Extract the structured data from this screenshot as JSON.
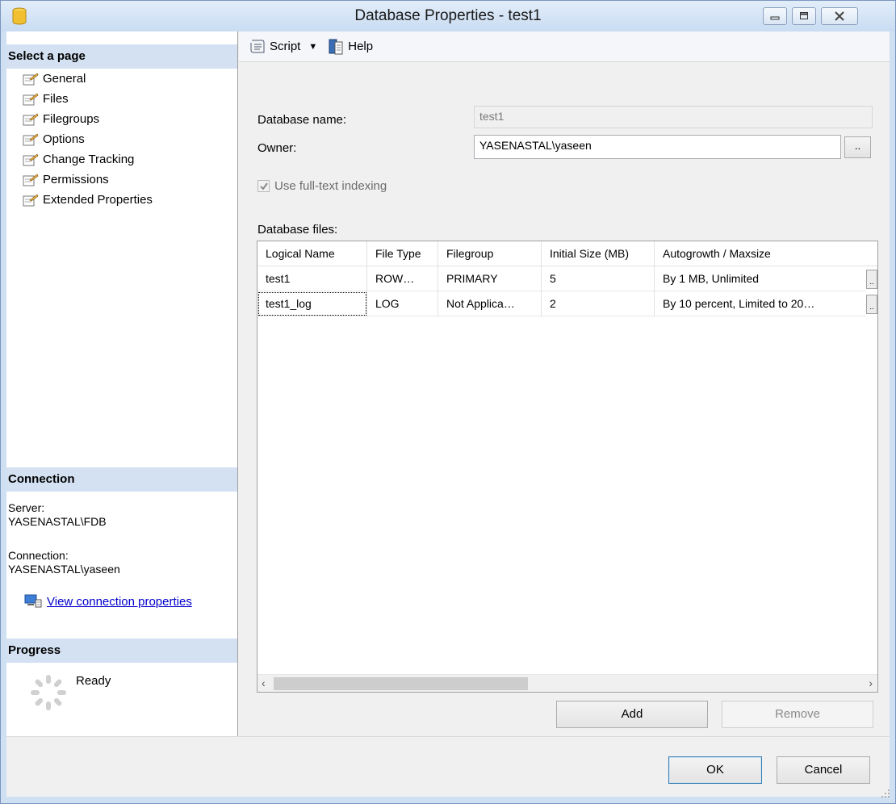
{
  "window": {
    "title": "Database Properties - test1"
  },
  "left_pane": {
    "select_page_header": "Select a page",
    "pages": [
      {
        "label": "General"
      },
      {
        "label": "Files"
      },
      {
        "label": "Filegroups"
      },
      {
        "label": "Options"
      },
      {
        "label": "Change Tracking"
      },
      {
        "label": "Permissions"
      },
      {
        "label": "Extended Properties"
      }
    ],
    "connection_header": "Connection",
    "server_label": "Server:",
    "server_value": "YASENASTAL\\FDB",
    "connection_label": "Connection:",
    "connection_value": "YASENASTAL\\yaseen",
    "view_connection_link": "View connection properties",
    "progress_header": "Progress",
    "progress_status": "Ready"
  },
  "toolbar": {
    "script_label": "Script",
    "help_label": "Help"
  },
  "form": {
    "database_name_label": "Database name:",
    "database_name_value": "test1",
    "owner_label": "Owner:",
    "owner_value": "YASENASTAL\\yaseen",
    "browse_label": "..",
    "fulltext_label": "Use full-text indexing",
    "fulltext_checked": true,
    "database_files_label": "Database files:"
  },
  "grid": {
    "columns": [
      "Logical Name",
      "File Type",
      "Filegroup",
      "Initial Size (MB)",
      "Autogrowth / Maxsize"
    ],
    "rows": [
      [
        "test1",
        "ROW…",
        "PRIMARY",
        "5",
        "By 1 MB, Unlimited"
      ],
      [
        "test1_log",
        "LOG",
        "Not Applica…",
        "2",
        "By 10 percent, Limited to 20…"
      ]
    ],
    "cell_button_label": ".."
  },
  "buttons": {
    "add": "Add",
    "remove": "Remove",
    "ok": "OK",
    "cancel": "Cancel"
  }
}
